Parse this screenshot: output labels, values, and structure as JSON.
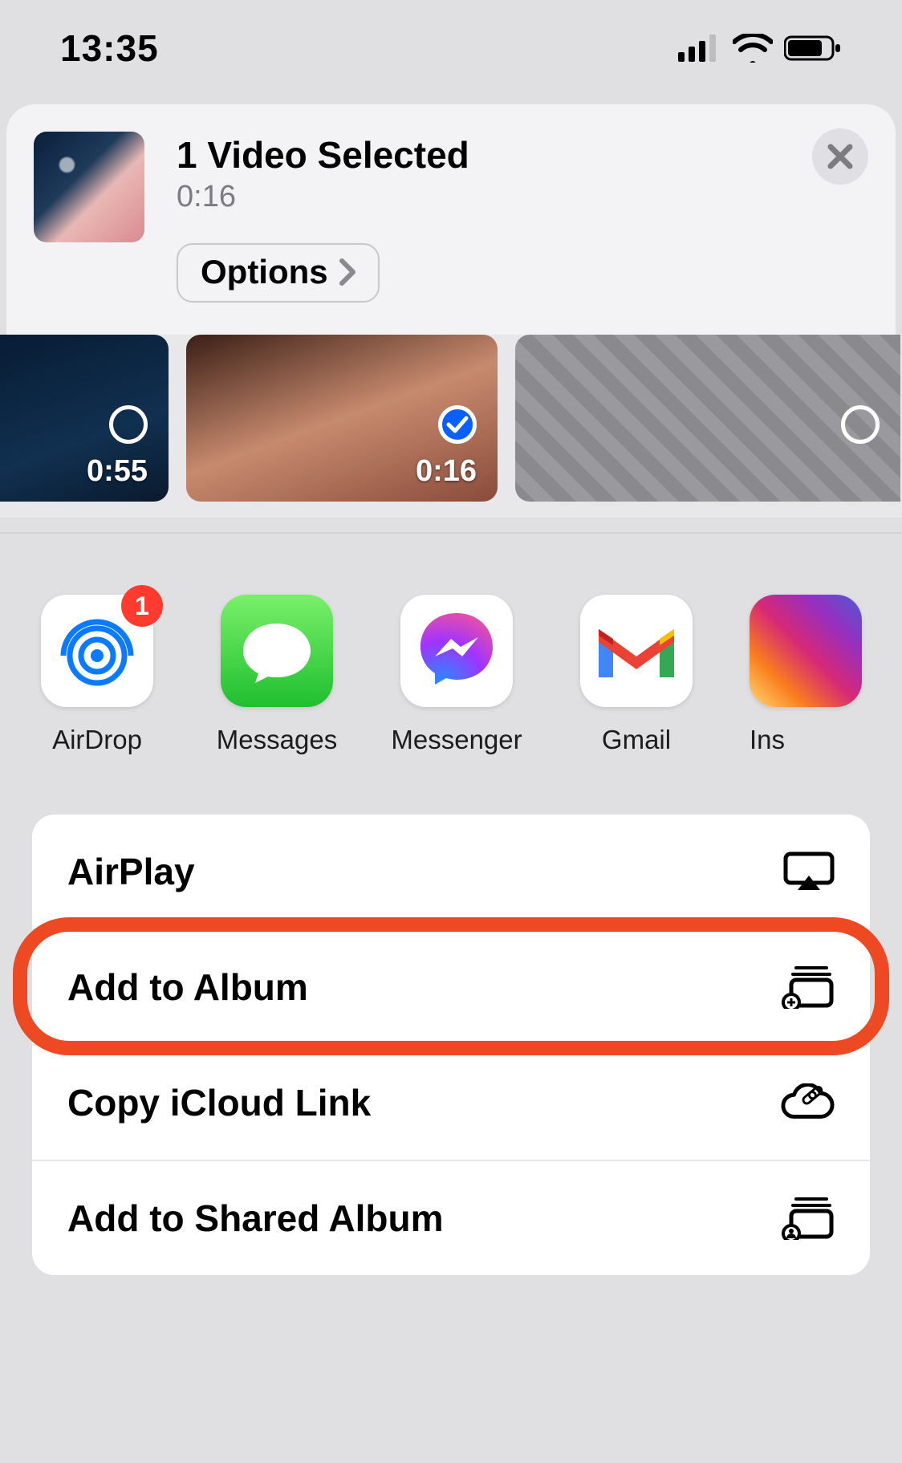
{
  "status": {
    "time": "13:35"
  },
  "share": {
    "title": "1 Video Selected",
    "duration": "0:16",
    "options_label": "Options"
  },
  "media": [
    {
      "duration": "0:55",
      "selected": false
    },
    {
      "duration": "0:16",
      "selected": true
    },
    {
      "duration": "",
      "selected": false
    }
  ],
  "apps": [
    {
      "label": "AirDrop",
      "badge": "1"
    },
    {
      "label": "Messages"
    },
    {
      "label": "Messenger"
    },
    {
      "label": "Gmail"
    },
    {
      "label": "Ins"
    }
  ],
  "actions": [
    {
      "label": "AirPlay",
      "icon": "airplay"
    },
    {
      "label": "Add to Album",
      "icon": "add-album",
      "highlight": true
    },
    {
      "label": "Copy iCloud Link",
      "icon": "icloud-link"
    },
    {
      "label": "Add to Shared Album",
      "icon": "shared-album"
    }
  ]
}
